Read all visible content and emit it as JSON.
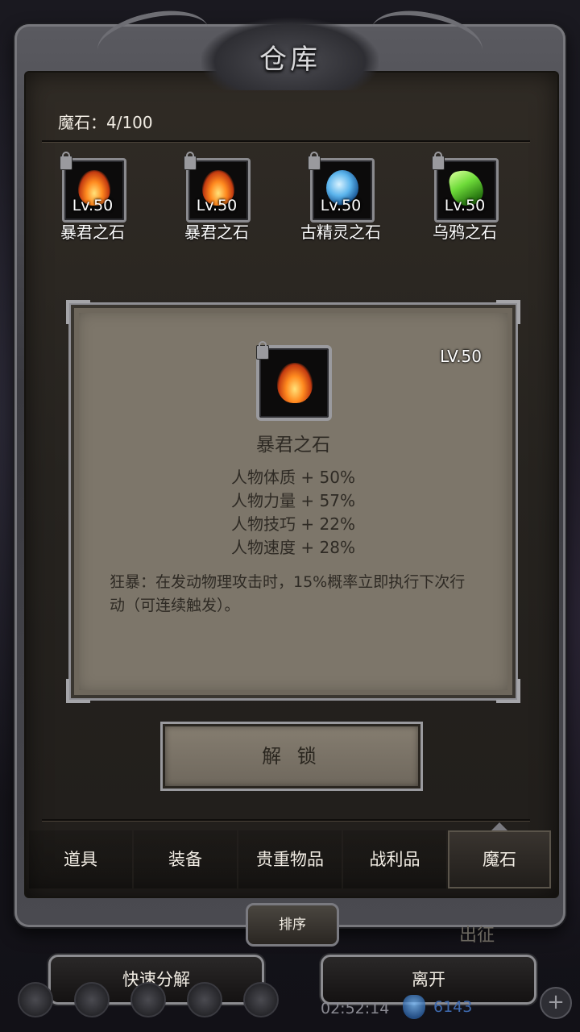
{
  "window": {
    "title": "仓库"
  },
  "header": {
    "stat": "魔石：4/100"
  },
  "stones": [
    {
      "lv": "Lv.50",
      "name": "暴君之石",
      "icon": "fire-stone-icon"
    },
    {
      "lv": "Lv.50",
      "name": "暴君之石",
      "icon": "fire-stone-icon"
    },
    {
      "lv": "Lv.50",
      "name": "古精灵之石",
      "icon": "blue-orb-stone-icon"
    },
    {
      "lv": "Lv.50",
      "name": "乌鸦之石",
      "icon": "green-crystal-stone-icon"
    }
  ],
  "detail": {
    "lv": "LV.50",
    "name": "暴君之石",
    "stats": [
      "人物体质 + 50%",
      "人物力量 + 57%",
      "人物技巧 + 22%",
      "人物速度 + 28%"
    ],
    "description": "狂暴：在发动物理攻击时，15%概率立即执行下次行动（可连续触发）。"
  },
  "unlock_button": "解 锁",
  "tabs": [
    {
      "label": "道具",
      "active": false
    },
    {
      "label": "装备",
      "active": false
    },
    {
      "label": "贵重物品",
      "active": false
    },
    {
      "label": "战利品",
      "active": false
    },
    {
      "label": "魔石",
      "active": true
    }
  ],
  "sort_button": "排序",
  "expedition_label": "出征",
  "bottom": {
    "quick_decompose": "快速分解",
    "leave": "离开"
  },
  "hud": {
    "timer": "02:52:14",
    "gems": "6143"
  },
  "colors": {
    "panel": "#7d766a",
    "frame": "#4a4a50",
    "text_dark": "#2e2a24"
  }
}
